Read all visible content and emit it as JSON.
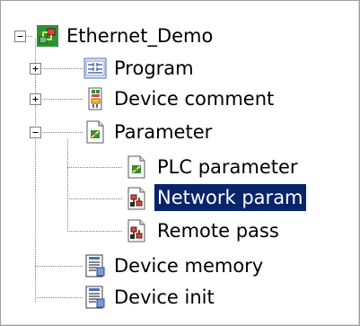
{
  "tree": {
    "root": {
      "label": "Ethernet_Demo",
      "expanded": true,
      "icon": "project-icon"
    },
    "items": [
      {
        "label": "Program",
        "icon": "program-icon",
        "expandable": true,
        "expanded": false
      },
      {
        "label": "Device comment",
        "icon": "device-comment-icon",
        "expandable": true,
        "expanded": false
      },
      {
        "label": "Parameter",
        "icon": "parameter-icon",
        "expandable": true,
        "expanded": true,
        "children": [
          {
            "label": "PLC parameter",
            "icon": "plc-parameter-icon"
          },
          {
            "label": "Network param",
            "icon": "network-param-icon",
            "selected": true
          },
          {
            "label": "Remote pass",
            "icon": "remote-pass-icon"
          }
        ]
      },
      {
        "label": "Device memory",
        "icon": "device-memory-icon"
      },
      {
        "label": "Device init",
        "icon": "device-init-icon"
      }
    ]
  },
  "colors": {
    "selection": "#0a246a",
    "selection_text": "#ffffff",
    "tree_lines": "#808080"
  }
}
